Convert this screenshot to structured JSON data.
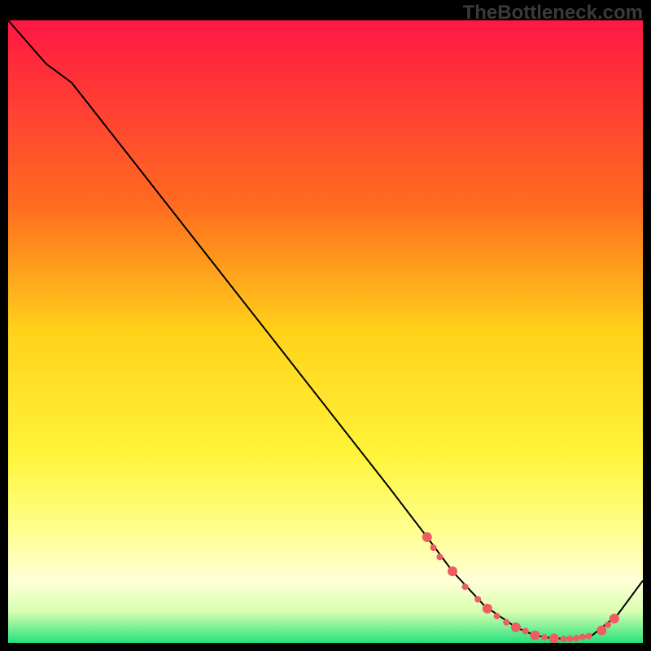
{
  "watermark": "TheBottleneck.com",
  "chart_data": {
    "type": "line",
    "title": "",
    "xlabel": "",
    "ylabel": "",
    "xlim": [
      0,
      100
    ],
    "ylim": [
      0,
      100
    ],
    "gradient_stops": [
      {
        "offset": 0,
        "color": "#ff1744"
      },
      {
        "offset": 30,
        "color": "#ff6d1f"
      },
      {
        "offset": 50,
        "color": "#ffd21a"
      },
      {
        "offset": 70,
        "color": "#fff43a"
      },
      {
        "offset": 82,
        "color": "#ffff8f"
      },
      {
        "offset": 90,
        "color": "#ffffd8"
      },
      {
        "offset": 95,
        "color": "#d8ffb0"
      },
      {
        "offset": 100,
        "color": "#25e27d"
      }
    ],
    "series": [
      {
        "name": "bottleneck-curve",
        "stroke": "#000000",
        "x": [
          0,
          6,
          10,
          20,
          30,
          40,
          50,
          60,
          66,
          70,
          75,
          80,
          83,
          86,
          89,
          92,
          96,
          100
        ],
        "values": [
          100,
          93,
          90,
          77,
          64,
          51,
          38,
          25,
          17,
          11.5,
          6,
          2.5,
          1.2,
          0.7,
          0.7,
          1.2,
          4.5,
          10
        ]
      }
    ],
    "highlight_points": {
      "color": "#ef5d63",
      "radius_major": 6,
      "radius_minor": 4,
      "points": [
        {
          "x": 66.0,
          "y": 17.0,
          "r": "major"
        },
        {
          "x": 67.0,
          "y": 15.3,
          "r": "minor"
        },
        {
          "x": 68.0,
          "y": 13.8,
          "r": "minor"
        },
        {
          "x": 70.0,
          "y": 11.5,
          "r": "major"
        },
        {
          "x": 72.0,
          "y": 9.0,
          "r": "minor"
        },
        {
          "x": 74.0,
          "y": 7.0,
          "r": "minor"
        },
        {
          "x": 75.5,
          "y": 5.5,
          "r": "major"
        },
        {
          "x": 77.0,
          "y": 4.3,
          "r": "minor"
        },
        {
          "x": 78.5,
          "y": 3.3,
          "r": "minor"
        },
        {
          "x": 80.0,
          "y": 2.5,
          "r": "major"
        },
        {
          "x": 81.5,
          "y": 1.9,
          "r": "minor"
        },
        {
          "x": 83.0,
          "y": 1.2,
          "r": "major"
        },
        {
          "x": 84.5,
          "y": 0.9,
          "r": "minor"
        },
        {
          "x": 86.0,
          "y": 0.7,
          "r": "major"
        },
        {
          "x": 87.5,
          "y": 0.6,
          "r": "minor"
        },
        {
          "x": 88.5,
          "y": 0.65,
          "r": "minor"
        },
        {
          "x": 89.5,
          "y": 0.75,
          "r": "minor"
        },
        {
          "x": 90.5,
          "y": 0.95,
          "r": "minor"
        },
        {
          "x": 91.5,
          "y": 1.1,
          "r": "minor"
        },
        {
          "x": 93.5,
          "y": 2.0,
          "r": "major"
        },
        {
          "x": 94.5,
          "y": 2.9,
          "r": "minor"
        },
        {
          "x": 95.5,
          "y": 3.9,
          "r": "major"
        }
      ]
    }
  }
}
